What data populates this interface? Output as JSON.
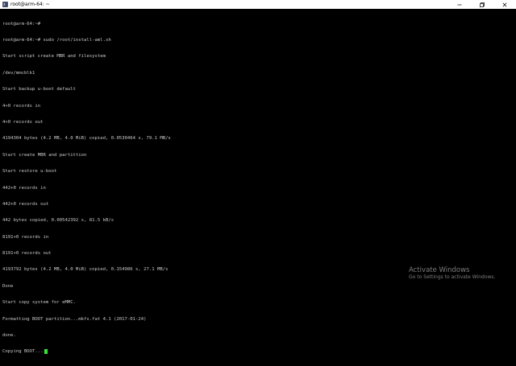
{
  "window": {
    "title": "root@arm-64: ~",
    "icon": "terminal-icon",
    "controls": [
      "minimize-icon",
      "maximize-icon",
      "close-icon"
    ]
  },
  "terminal": {
    "lines": [
      "root@arm-64:~#",
      "root@arm-64:~# sudo /root/install-aml.sh",
      "Start script create MBR and filesystem",
      "/dev/mmcblk1",
      "Start backup u-boot default",
      "4+0 records in",
      "4+0 records out",
      "4194304 bytes (4.2 MB, 4.0 MiB) copied, 0.0530464 s, 79.1 MB/s",
      "Start create MBR and partittion",
      "Start restore u-boot",
      "442+0 records in",
      "442+0 records out",
      "442 bytes copied, 0.00542392 s, 81.5 kB/s",
      "8191+0 records in",
      "8191+0 records out",
      "4193792 bytes (4.2 MB, 4.0 MiB) copied, 0.154986 s, 27.1 MB/s",
      "Done",
      "Start copy system for eMMC.",
      "Formatting BOOT partition...mkfs.fat 4.1 (2017-01-24)",
      "done.",
      "Copying BOOT..."
    ],
    "cursor_color": "#39e039",
    "text_color": "#c8c8c8",
    "background": "#000000"
  },
  "watermark": {
    "title": "Activate Windows",
    "subtitle": "Go to Settings to activate Windows."
  }
}
